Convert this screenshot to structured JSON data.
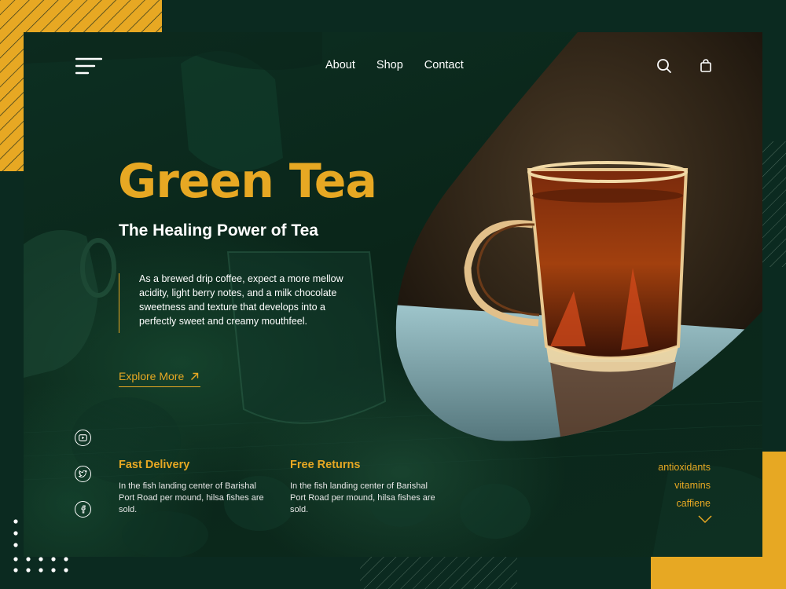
{
  "nav": {
    "items": [
      {
        "label": "About"
      },
      {
        "label": "Shop"
      },
      {
        "label": "Contact"
      }
    ]
  },
  "icons": {
    "menu": "menu-icon",
    "search": "search-icon",
    "cart": "shopping-bag-icon",
    "arrow": "arrow-up-right-icon",
    "youtube": "youtube-icon",
    "twitter": "twitter-icon",
    "facebook": "facebook-icon",
    "chevron": "chevron-down-icon"
  },
  "hero": {
    "title": "Green Tea",
    "subtitle": "The Healing Power of Tea",
    "description": "As a brewed drip coffee, expect a more mellow acidity, light berry notes, and a milk chocolate sweetness and texture that develops into a perfectly sweet and creamy mouthfeel.",
    "cta_label": "Explore More"
  },
  "features": [
    {
      "title": "Fast Delivery",
      "text": "In the fish landing center of Barishal Port Road per mound, hilsa fishes are sold."
    },
    {
      "title": "Free Returns",
      "text": "In the fish landing center of Barishal Port Road per mound, hilsa fishes are sold."
    }
  ],
  "tags": [
    "antioxidants",
    "vitamins",
    "caffiene"
  ],
  "colors": {
    "accent": "#e7a823",
    "background": "#0b2a20",
    "card": "#0d2f22",
    "text": "#ffffff"
  }
}
